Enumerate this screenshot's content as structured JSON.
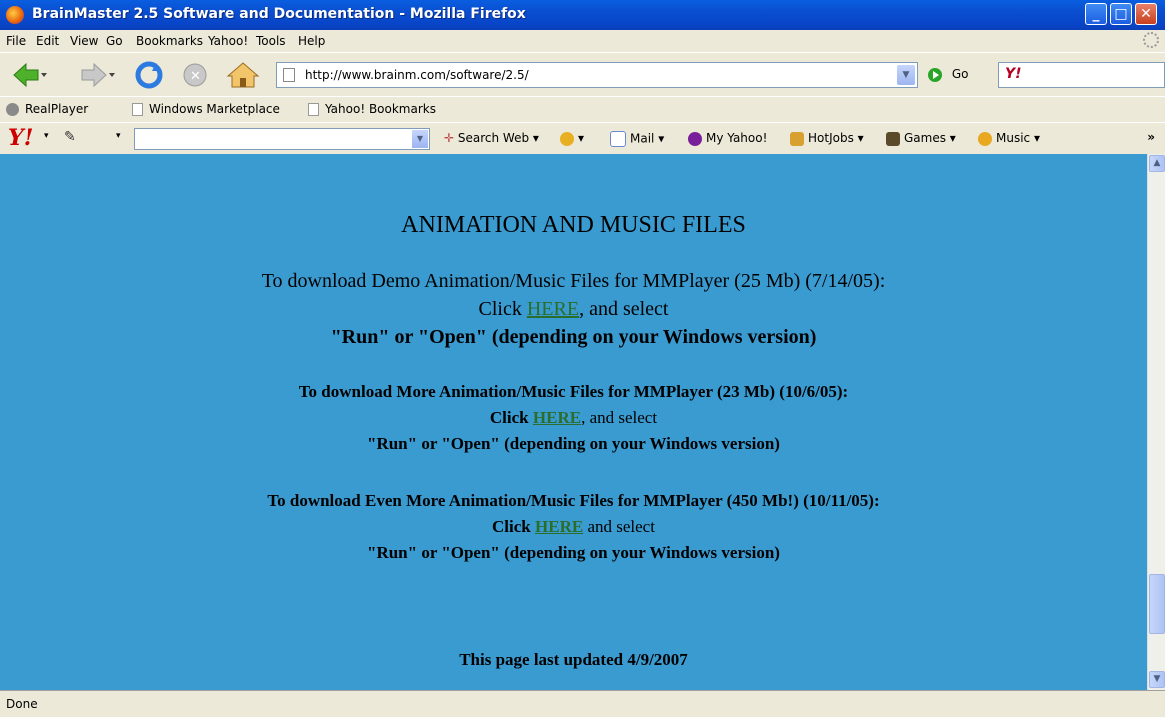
{
  "window": {
    "title": "BrainMaster 2.5 Software and Documentation - Mozilla Firefox"
  },
  "menu": [
    {
      "label": "File"
    },
    {
      "label": "Edit"
    },
    {
      "label": "View"
    },
    {
      "label": "Go"
    },
    {
      "label": "Bookmarks"
    },
    {
      "label": "Yahoo!"
    },
    {
      "label": "Tools"
    },
    {
      "label": "Help"
    }
  ],
  "navbar": {
    "url": "http://www.brainm.com/software/2.5/",
    "go_label": "Go"
  },
  "bookmarks": [
    {
      "label": "RealPlayer"
    },
    {
      "label": "Windows Marketplace"
    },
    {
      "label": "Yahoo! Bookmarks"
    }
  ],
  "yahoo_toolbar": {
    "search_label": "Search Web",
    "mail": "Mail",
    "my_yahoo": "My Yahoo!",
    "hotjobs": "HotJobs",
    "games": "Games",
    "music": "Music",
    "more": "»"
  },
  "page": {
    "heading": "ANIMATION AND MUSIC FILES",
    "s1": {
      "line1": "To download Demo Animation/Music Files for MMPlayer (25 Mb) (7/14/05):",
      "click": "Click",
      "link": "HERE",
      "after": ", and select",
      "line3": "\"Run\" or \"Open\" (depending on your Windows version)"
    },
    "s2": {
      "line1": "To download More Animation/Music Files for MMPlayer (23 Mb) (10/6/05):",
      "click": "Click",
      "link": "HERE",
      "after": ", and select",
      "line3": "\"Run\" or \"Open\" (depending on your Windows version)"
    },
    "s3": {
      "line1": "To download Even More Animation/Music Files for MMPlayer (450 Mb!) (10/11/05):",
      "click": "Click",
      "link": "HERE",
      "after": " and select",
      "line3": "\"Run\" or \"Open\" (depending on your Windows version)"
    },
    "updated": "This page last updated 4/9/2007"
  },
  "status": "Done",
  "colors": {
    "page_bg": "#3a9bd1",
    "link": "#2b6e2b",
    "titlebar": "#0a4ed0"
  }
}
